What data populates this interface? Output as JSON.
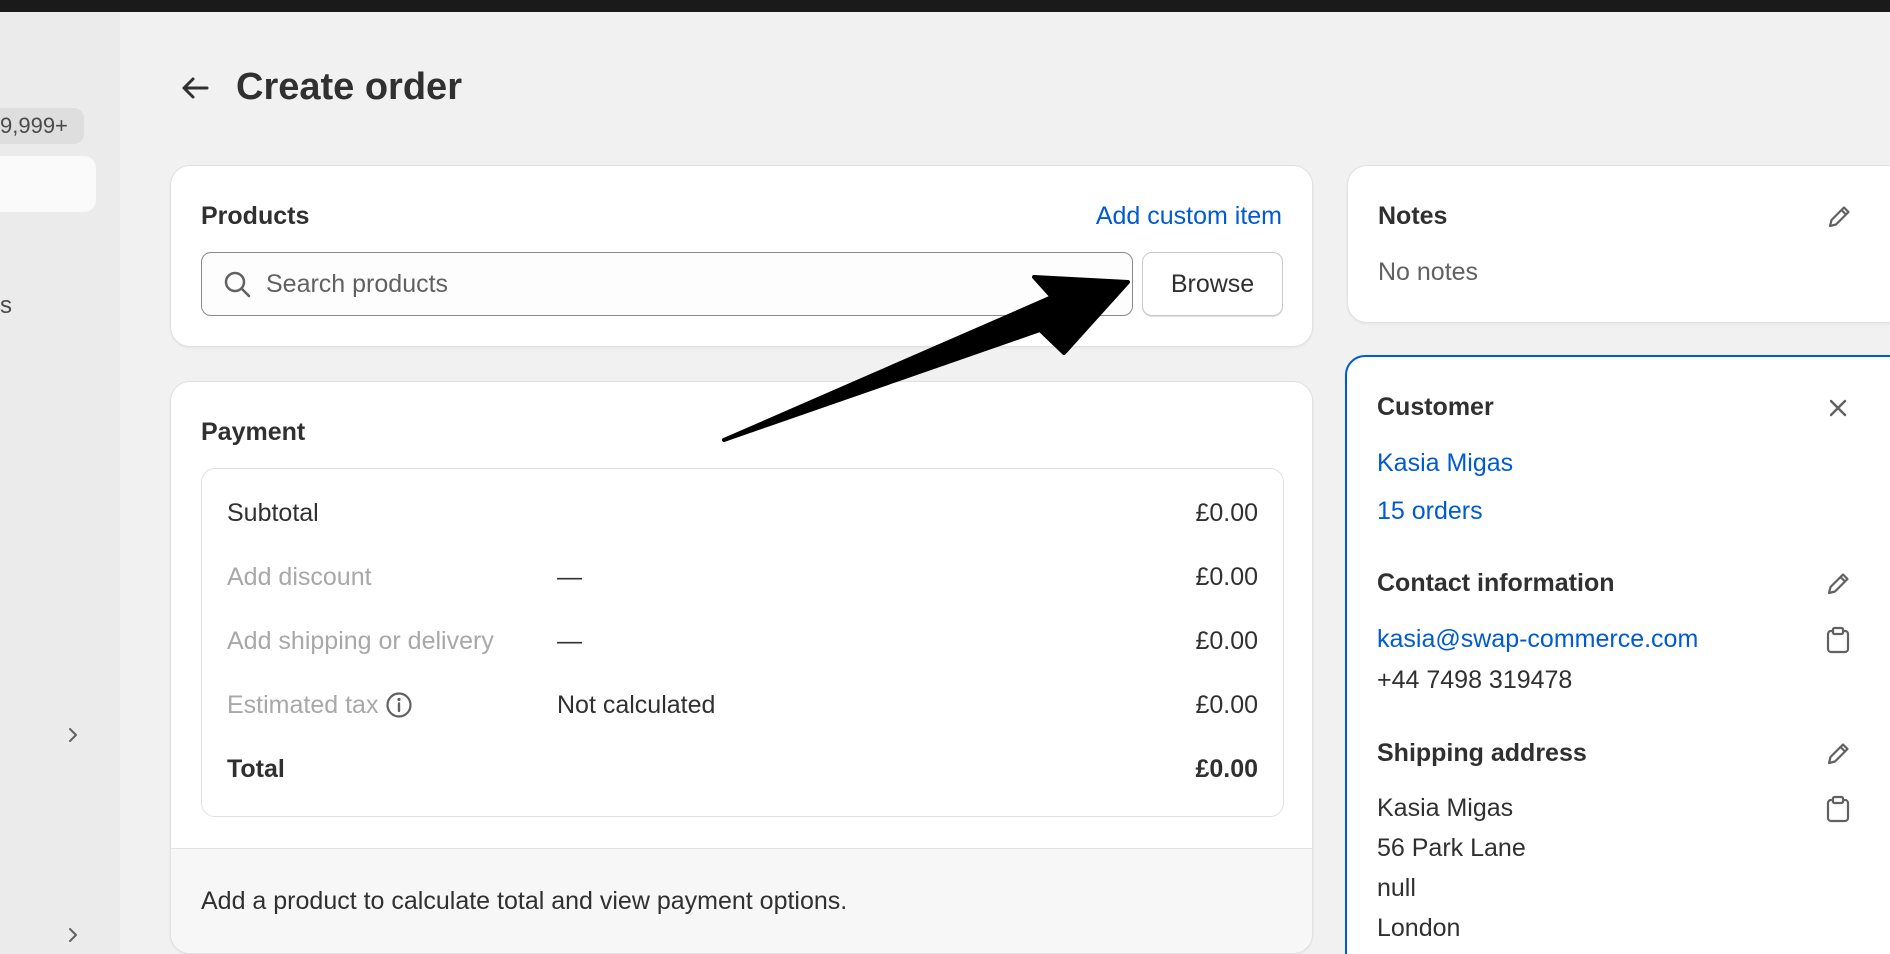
{
  "sidebar": {
    "badge": "9,999+",
    "item_fragment": "s"
  },
  "page": {
    "title": "Create order"
  },
  "products": {
    "title": "Products",
    "add_custom_item": "Add custom item",
    "search_placeholder": "Search products",
    "browse_label": "Browse"
  },
  "payment": {
    "title": "Payment",
    "rows": [
      {
        "label": "Subtotal",
        "middle": "",
        "amount": "£0.00"
      },
      {
        "label": "Add discount",
        "middle": "—",
        "amount": "£0.00"
      },
      {
        "label": "Add shipping or delivery",
        "middle": "—",
        "amount": "£0.00"
      },
      {
        "label": "Estimated tax",
        "middle": "Not calculated",
        "amount": "£0.00"
      },
      {
        "label": "Total",
        "middle": "",
        "amount": "£0.00"
      }
    ],
    "footer_text": "Add a product to calculate total and view payment options."
  },
  "notes": {
    "title": "Notes",
    "text": "No notes"
  },
  "customer": {
    "title": "Customer",
    "name": "Kasia Migas",
    "orders": "15 orders",
    "contact_title": "Contact information",
    "email": "kasia@swap-commerce.com",
    "phone": "+44 7498 319478",
    "shipping_title": "Shipping address",
    "address_lines": [
      "Kasia Migas",
      "56 Park Lane",
      "null",
      "London"
    ]
  },
  "colors": {
    "accent": "#005bd3",
    "background": "#f1f1f1",
    "card": "#ffffff"
  }
}
